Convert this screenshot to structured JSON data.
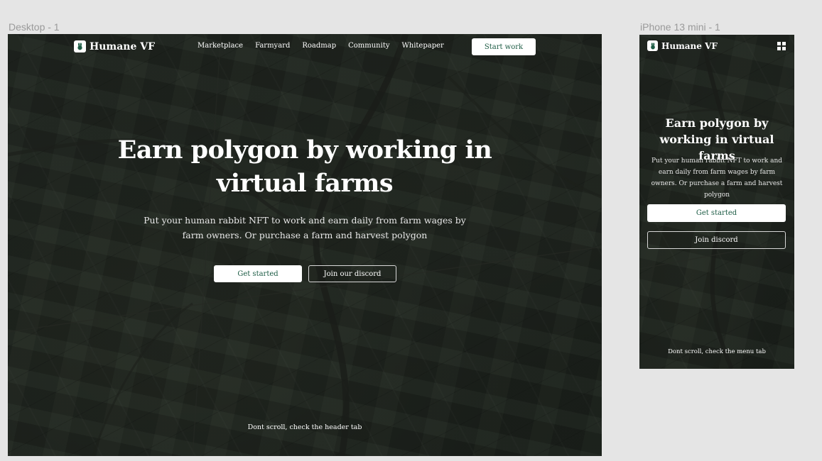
{
  "colors": {
    "canvas": "#e5e5e5",
    "accent": "#1d5c45",
    "label": "#9a9a9a"
  },
  "desktop": {
    "frame_label": "Desktop - 1",
    "brand": "Humane VF",
    "logo_icon": "rabbit-logo-icon",
    "nav": [
      "Marketplace",
      "Farmyard",
      "Roadmap",
      "Community",
      "Whitepaper"
    ],
    "cta": "Start work",
    "title": "Earn polygon by working in virtual farms",
    "subtitle": "Put your human rabbit NFT to work and earn daily from farm wages by farm owners. Or purchase a farm and harvest polygon",
    "primary_button": "Get started",
    "secondary_button": "Join our discord",
    "footer_hint": "Dont scroll, check the header tab"
  },
  "mobile": {
    "frame_label": "iPhone 13 mini - 1",
    "brand": "Humane VF",
    "logo_icon": "rabbit-logo-icon",
    "menu_icon": "grid-menu-icon",
    "title": "Earn polygon by working in virtual farms",
    "subtitle": "Put your human rabbit NFT to work and earn daily from farm wages by farm owners. Or purchase a farm and harvest polygon",
    "primary_button": "Get started",
    "secondary_button": "Join discord",
    "footer_hint": "Dont scroll, check the menu tab"
  }
}
